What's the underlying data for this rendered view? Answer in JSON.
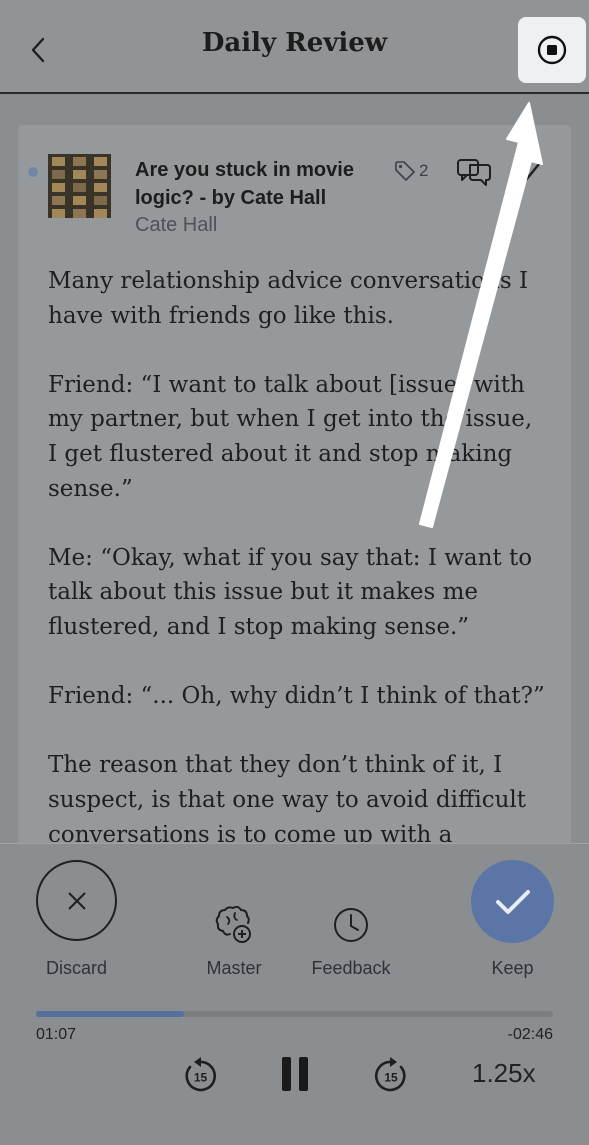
{
  "header": {
    "title": "Daily Review",
    "back_icon": "chevron-left-icon",
    "stop_icon": "stop-record-icon"
  },
  "article": {
    "title": "Are you stuck in movie logic? - by Cate Hall",
    "author": "Cate Hall",
    "tag_count": "2",
    "paragraphs": [
      "Many relationship advice conversations I have with friends go like this.",
      "Friend: “I want to talk about [issue] with my partner, but when I get into the issue, I get flustered about it and stop making sense.”",
      "Me: “Okay, what if you say that: I want to talk about this issue but it makes me flustered, and I stop making sense.”",
      "Friend: “... Oh, why didn’t I think of that?”",
      "The reason that they don’t think of it, I suspect, is that one way to avoid difficult conversations is to come up with a"
    ]
  },
  "actions": {
    "discard": "Discard",
    "master": "Master",
    "feedback": "Feedback",
    "keep": "Keep"
  },
  "player": {
    "elapsed": "01:07",
    "remaining": "-02:46",
    "progress": 0.287,
    "skip_back": "15",
    "skip_forward": "15",
    "speed": "1.25x"
  },
  "colors": {
    "accent": "#5c75a7",
    "progress": "#56709e"
  }
}
